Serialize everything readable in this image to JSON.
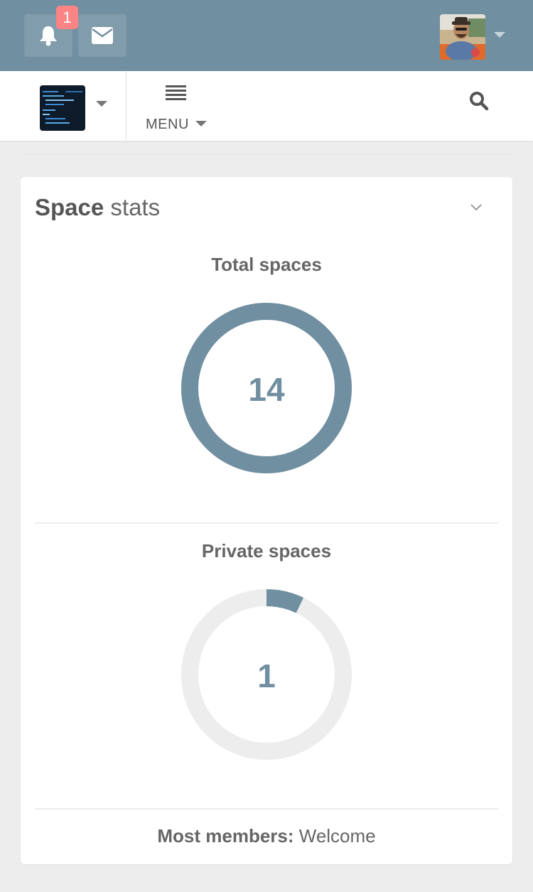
{
  "topbar": {
    "notifications": {
      "badge_count": "1",
      "icon": "bell-icon"
    },
    "messages": {
      "icon": "envelope-icon"
    },
    "user": {
      "avatar": "user-avatar",
      "menu_icon": "caret-down-icon"
    }
  },
  "navbar": {
    "space_chooser": {
      "icon": "space-thumbnail"
    },
    "menu": {
      "label": "MENU",
      "icon": "hamburger-icon"
    },
    "search": {
      "icon": "search-icon"
    }
  },
  "panel": {
    "title_bold": "Space",
    "title_rest": "stats",
    "collapse_icon": "chevron-down-icon",
    "stats": [
      {
        "label": "Total spaces",
        "value": "14",
        "fraction": 1.0
      },
      {
        "label": "Private spaces",
        "value": "1",
        "fraction": 0.0714
      }
    ],
    "most_members_label": "Most members:",
    "most_members_value": "Welcome"
  },
  "colors": {
    "topbar": "#708fa0",
    "accent": "#708fa0",
    "badge": "#fc8484",
    "ring_track": "#ededed",
    "background": "#ededed"
  }
}
